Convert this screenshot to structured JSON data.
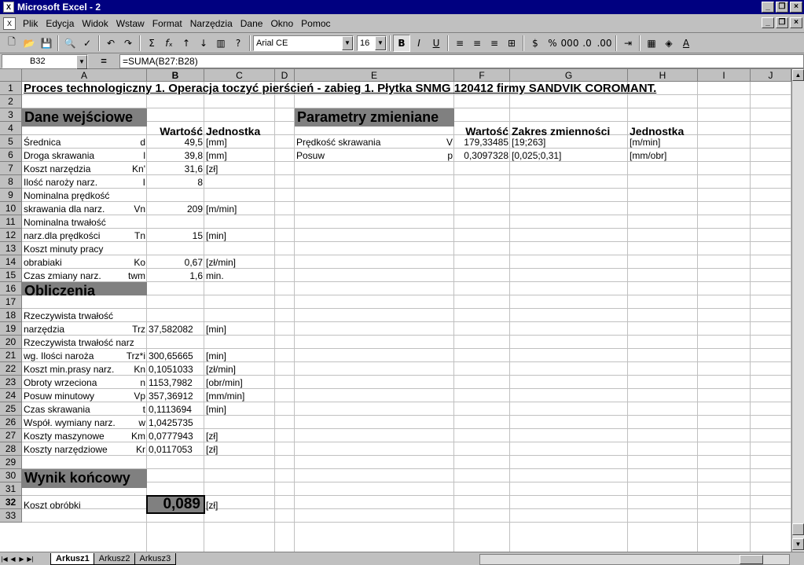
{
  "window": {
    "title": "Microsoft Excel - 2"
  },
  "menu": [
    "Plik",
    "Edycja",
    "Widok",
    "Wstaw",
    "Format",
    "Narzędzia",
    "Dane",
    "Okno",
    "Pomoc"
  ],
  "toolbar": {
    "font": "Arial CE",
    "size": "16"
  },
  "formula": {
    "cell": "B32",
    "eq": "=",
    "value": "=SUMA(B27:B28)"
  },
  "columns": [
    "A",
    "B",
    "C",
    "D",
    "E",
    "F",
    "G",
    "H",
    "I",
    "J"
  ],
  "rows": [
    "1",
    "2",
    "3",
    "4",
    "5",
    "6",
    "7",
    "8",
    "9",
    "10",
    "11",
    "12",
    "13",
    "14",
    "15",
    "16",
    "17",
    "18",
    "19",
    "20",
    "21",
    "22",
    "23",
    "24",
    "25",
    "26",
    "27",
    "28",
    "29",
    "30",
    "31",
    "32",
    "33"
  ],
  "sheet": {
    "title": "Proces technologiczny 1.  Operacja toczyć pierścień - zabieg 1.  Płytka SNMG 120412 firmy SANDVIK COROMANT.",
    "input_header": "Dane wejściowe",
    "var_header": "Parametry zmieniane",
    "col_value": "Wartość",
    "col_unit": "Jednostka",
    "col_range": "Zakres zmienności",
    "calc_header": "Obliczenia",
    "result_header": "Wynik końcowy",
    "result_label": "Koszt obróbki",
    "result_value": "0,089",
    "result_unit": "[zł]"
  },
  "inputs": [
    {
      "l": "Średnica",
      "s": "d",
      "v": "49,5",
      "u": "[mm]"
    },
    {
      "l": "Droga skrawania",
      "s": "l",
      "v": "39,8",
      "u": "[mm]"
    },
    {
      "l": "Koszt narzędzia",
      "s": "Kn'",
      "v": "31,6",
      "u": "[zł]"
    },
    {
      "l": "Ilość naroży narz.",
      "s": "I",
      "v": "8",
      "u": ""
    },
    {
      "l": "Nominalna prędkość",
      "s": "",
      "v": "",
      "u": ""
    },
    {
      "l": "skrawania dla narz.",
      "s": "Vn",
      "v": "209",
      "u": "[m/min]"
    },
    {
      "l": "Nominalna trwałość",
      "s": "",
      "v": "",
      "u": ""
    },
    {
      "l": "narz.dla prędkości",
      "s": "Tn",
      "v": "15",
      "u": "[min]"
    },
    {
      "l": "Koszt minuty pracy",
      "s": "",
      "v": "",
      "u": ""
    },
    {
      "l": "obrabiaki",
      "s": "Ko",
      "v": "0,67",
      "u": "[zł/min]"
    },
    {
      "l": "Czas zmiany narz.",
      "s": "twm",
      "v": "1,6",
      "u": "min."
    }
  ],
  "variables": [
    {
      "l": "Prędkość skrawania",
      "s": "V",
      "v": "179,33485",
      "r": "[19;263]",
      "u": "[m/min]"
    },
    {
      "l": "Posuw",
      "s": "p",
      "v": "0,3097328",
      "r": "[0,025;0,31]",
      "u": "[mm/obr]"
    }
  ],
  "calcs": [
    {
      "row": 18,
      "l": "Rzeczywista trwałość",
      "s": "",
      "v": "",
      "u": ""
    },
    {
      "row": 19,
      "l": "narzędzia",
      "s": "Trz",
      "v": "37,582082",
      "u": "[min]"
    },
    {
      "row": 20,
      "l": "Rzeczywista trwałość narz",
      "s": "",
      "v": "",
      "u": ""
    },
    {
      "row": 21,
      "l": " wg. Ilości naroża",
      "s": "Trz*i",
      "v": "300,65665",
      "u": "[min]"
    },
    {
      "row": 22,
      "l": "Koszt min.prasy narz.",
      "s": "Kn",
      "v": "0,1051033",
      "u": "[zł/min]"
    },
    {
      "row": 23,
      "l": "Obroty wrzeciona",
      "s": "n",
      "v": "1153,7982",
      "u": "[obr/min]"
    },
    {
      "row": 24,
      "l": "Posuw minutowy",
      "s": "Vp",
      "v": "357,36912",
      "u": "[mm/min]"
    },
    {
      "row": 25,
      "l": "Czas skrawania",
      "s": "t",
      "v": "0,1113694",
      "u": "[min]"
    },
    {
      "row": 26,
      "l": "Współ. wymiany narz.",
      "s": "w",
      "v": "1,0425735",
      "u": ""
    },
    {
      "row": 27,
      "l": "Koszty maszynowe",
      "s": "Km",
      "v": "0,0777943",
      "u": "[zł]"
    },
    {
      "row": 28,
      "l": "Koszty narzędziowe",
      "s": "Kr",
      "v": "0,0117053",
      "u": "[zł]"
    }
  ],
  "tabs": [
    "Arkusz1",
    "Arkusz2",
    "Arkusz3"
  ]
}
